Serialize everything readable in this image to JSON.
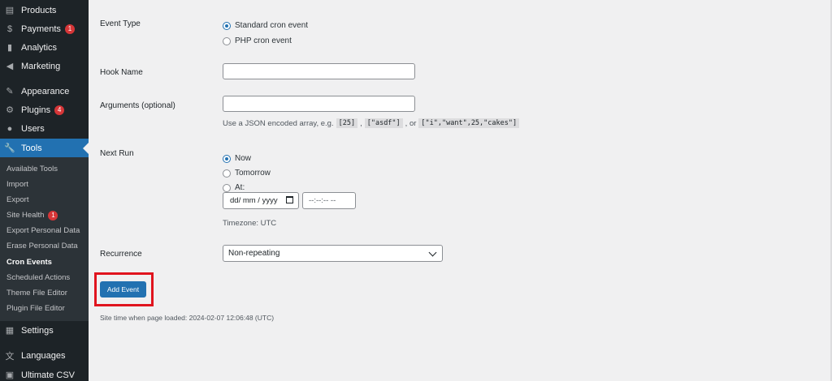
{
  "sidebar": {
    "items": [
      {
        "label": "Products",
        "icon": "products-icon",
        "glyph": "▤",
        "badge": ""
      },
      {
        "label": "Payments",
        "icon": "payments-icon",
        "glyph": "$",
        "badge": "1"
      },
      {
        "label": "Analytics",
        "icon": "analytics-icon",
        "glyph": "▮",
        "badge": ""
      },
      {
        "label": "Marketing",
        "icon": "marketing-icon",
        "glyph": "◀",
        "badge": ""
      },
      {
        "label": "Appearance",
        "icon": "appearance-icon",
        "glyph": "✎",
        "badge": ""
      },
      {
        "label": "Plugins",
        "icon": "plugins-icon",
        "glyph": "⚙",
        "badge": "4"
      },
      {
        "label": "Users",
        "icon": "users-icon",
        "glyph": "●",
        "badge": ""
      },
      {
        "label": "Tools",
        "icon": "tools-icon",
        "glyph": "🔧",
        "badge": ""
      },
      {
        "label": "Settings",
        "icon": "settings-icon",
        "glyph": "▦",
        "badge": ""
      },
      {
        "label": "Languages",
        "icon": "languages-icon",
        "glyph": "文",
        "badge": ""
      },
      {
        "label": "Ultimate CSV",
        "icon": "ultimate-csv-icon",
        "glyph": "▣",
        "badge": ""
      }
    ],
    "submenu": [
      {
        "label": "Available Tools",
        "badge": ""
      },
      {
        "label": "Import",
        "badge": ""
      },
      {
        "label": "Export",
        "badge": ""
      },
      {
        "label": "Site Health",
        "badge": "1"
      },
      {
        "label": "Export Personal Data",
        "badge": ""
      },
      {
        "label": "Erase Personal Data",
        "badge": ""
      },
      {
        "label": "Cron Events",
        "badge": ""
      },
      {
        "label": "Scheduled Actions",
        "badge": ""
      },
      {
        "label": "Theme File Editor",
        "badge": ""
      },
      {
        "label": "Plugin File Editor",
        "badge": ""
      }
    ],
    "active_item": "Tools",
    "current_submenu": "Cron Events"
  },
  "form": {
    "event_type": {
      "label": "Event Type",
      "options": [
        "Standard cron event",
        "PHP cron event"
      ],
      "selected": "Standard cron event"
    },
    "hook_name": {
      "label": "Hook Name",
      "value": ""
    },
    "arguments": {
      "label": "Arguments (optional)",
      "value": "",
      "description_prefix": "Use a JSON encoded array, e.g.",
      "example1": "[25]",
      "sep1": ",",
      "example2": "[\"asdf\"]",
      "sep2": ", or",
      "example3": "[\"i\",\"want\",25,\"cakes\"]"
    },
    "next_run": {
      "label": "Next Run",
      "options": [
        "Now",
        "Tomorrow",
        "At:"
      ],
      "selected": "Now",
      "date_placeholder": "dd/ mm / yyyy",
      "time_placeholder": "--:--:--  --",
      "timezone": "Timezone: UTC"
    },
    "recurrence": {
      "label": "Recurrence",
      "value": "Non-repeating"
    },
    "submit_label": "Add Event",
    "site_time": "Site time when page loaded: 2024-02-07 12:06:48 (UTC)"
  },
  "colors": {
    "sidebar_bg": "#1d2327",
    "active_blue": "#2271b1",
    "badge_red": "#d63638",
    "highlight_red": "#e0141e"
  }
}
